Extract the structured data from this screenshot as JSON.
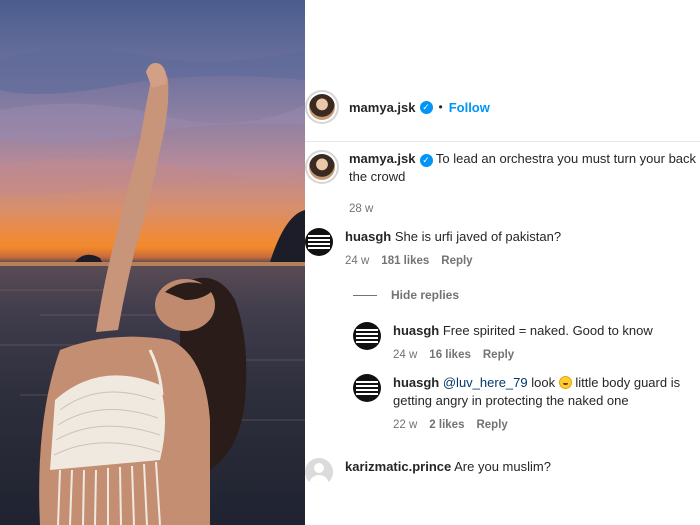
{
  "post": {
    "author": "mamya.jsk",
    "separator": "•",
    "follow_label": "Follow",
    "verified_icon": "verified-badge-icon"
  },
  "caption": {
    "username": "mamya.jsk",
    "text": "To lead an orchestra you must turn your back on the crowd",
    "time": "28 w"
  },
  "comments": [
    {
      "username": "huasgh",
      "text": "She is urfi javed of pakistan?",
      "time": "24 w",
      "likes": "181 likes",
      "reply_label": "Reply"
    }
  ],
  "hide_replies_label": "Hide replies",
  "replies": [
    {
      "username": "huasgh",
      "text": "Free spirited = naked. Good to know",
      "time": "24 w",
      "likes": "16 likes",
      "reply_label": "Reply"
    },
    {
      "username": "huasgh",
      "mention": "@luv_here_79",
      "text_a": " look ",
      "emoji": "laughing-emoji",
      "text_b": " little body guard is getting angry in protecting the naked one",
      "time": "22 w",
      "likes": "2 likes",
      "reply_label": "Reply"
    }
  ],
  "last_comment": {
    "username": "karizmatic.prince",
    "text": "Are you muslim?"
  },
  "colors": {
    "accent": "#0095f6",
    "muted": "#737373",
    "text": "#262626"
  }
}
